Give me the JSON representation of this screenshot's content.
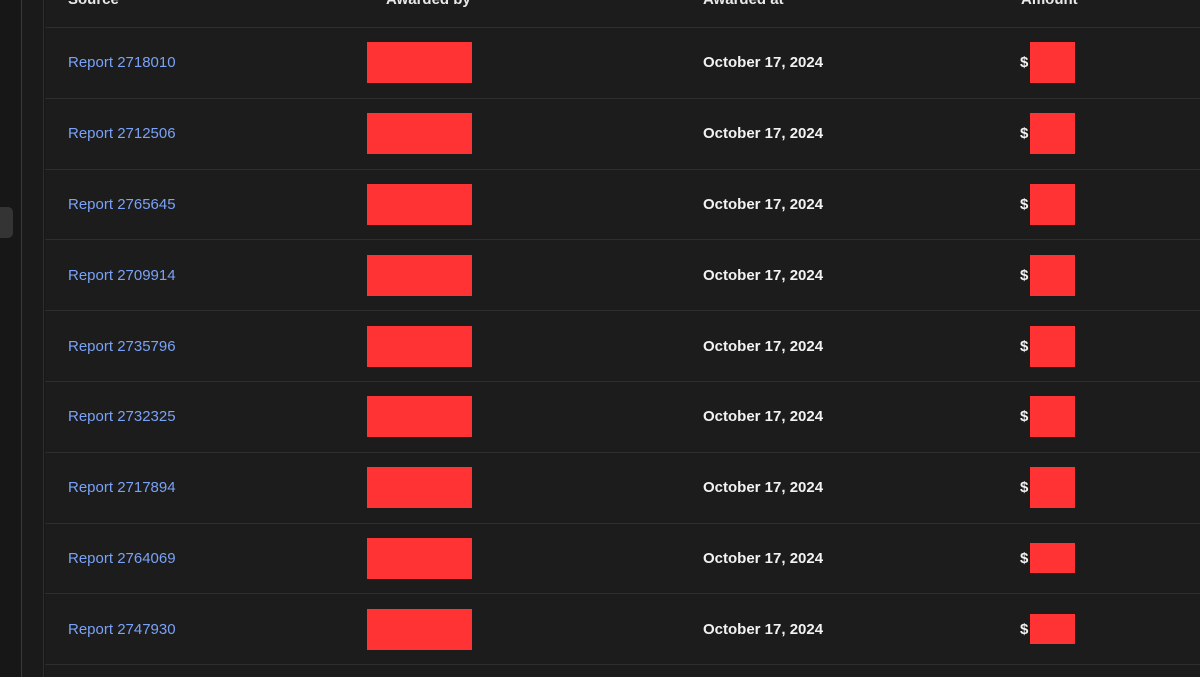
{
  "table": {
    "headers": {
      "source": "Source",
      "awarded_by": "Awarded by",
      "awarded_at": "Awarded at",
      "amount": "Amount"
    },
    "currency_symbol": "$",
    "rows": [
      {
        "source": "Report 2718010",
        "awarded_at": "October 17, 2024"
      },
      {
        "source": "Report 2712506",
        "awarded_at": "October 17, 2024"
      },
      {
        "source": "Report 2765645",
        "awarded_at": "October 17, 2024"
      },
      {
        "source": "Report 2709914",
        "awarded_at": "October 17, 2024"
      },
      {
        "source": "Report 2735796",
        "awarded_at": "October 17, 2024"
      },
      {
        "source": "Report 2732325",
        "awarded_at": "October 17, 2024"
      },
      {
        "source": "Report 2717894",
        "awarded_at": "October 17, 2024"
      },
      {
        "source": "Report 2764069",
        "awarded_at": "October 17, 2024"
      },
      {
        "source": "Report 2747930",
        "awarded_at": "October 17, 2024"
      }
    ]
  },
  "colors": {
    "link": "#7aa2f7",
    "redaction": "#ff3333",
    "background": "#1c1c1c"
  }
}
